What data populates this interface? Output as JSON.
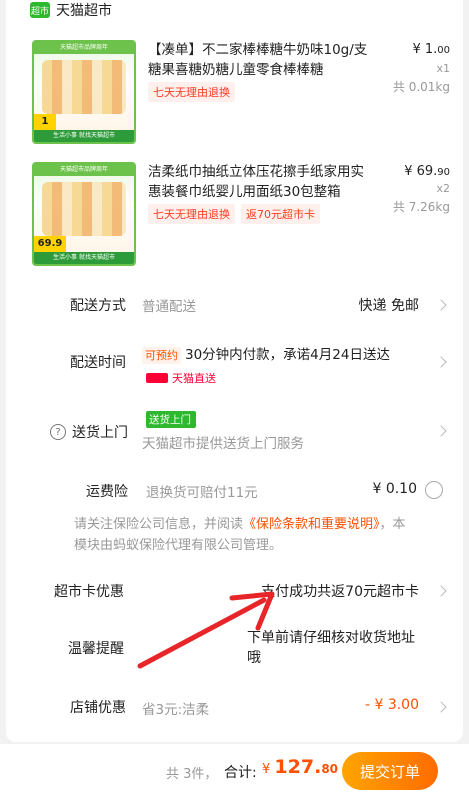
{
  "shop": {
    "logo_text": "超市",
    "name": "天猫超市"
  },
  "products": [
    {
      "thumb_banner": "天猫超市品牌周年",
      "thumb_footer": "生活小事 就找天猫超市",
      "thumb_price": "1",
      "title": "【凑单】不二家棒棒糖牛奶味10g/支糖果喜糖奶糖儿童零食棒棒糖",
      "tags": [
        "七天无理由退换"
      ],
      "price_main": "¥ 1.",
      "price_dec": "00",
      "qty": "x1",
      "weight": "共 0.01kg"
    },
    {
      "thumb_banner": "天猫超市品牌周年",
      "thumb_footer": "生活小事 就找天猫超市",
      "thumb_price": "69.9",
      "title": "洁柔纸巾抽纸立体压花擦手纸家用实惠装餐巾纸婴儿用面纸30包整箱",
      "tags": [
        "七天无理由退换",
        "返70元超市卡"
      ],
      "price_main": "¥ 69.",
      "price_dec": "90",
      "qty": "x2",
      "weight": "共 7.26kg"
    }
  ],
  "delivery_method": {
    "label": "配送方式",
    "value": "普通配送",
    "right": "快递 免邮"
  },
  "delivery_time": {
    "label": "配送时间",
    "badge": "可预约",
    "text": "30分钟内付款，承诺4月24日送达",
    "carrier": "天猫直送"
  },
  "door_delivery": {
    "label": "送货上门",
    "badge": "送货上门",
    "value": "天猫超市提供送货上门服务"
  },
  "shipping_insurance": {
    "label": "运费险",
    "value": "退换货可赔付11元",
    "right": "¥ 0.10"
  },
  "notice": {
    "prefix": "请关注保险公司信息，并阅读",
    "link": "《保险条款和重要说明》",
    "suffix": "，本模块由蚂蚁保险代理有限公司管理。"
  },
  "supermarket_card": {
    "label": "超市卡优惠",
    "right": "支付成功共返70元超市卡"
  },
  "reminder": {
    "label": "温馨提醒",
    "right": "下单前请仔细核对收货地址哦"
  },
  "shop_discount": {
    "label": "店铺优惠",
    "value": "省3元:洁柔",
    "right": "- ¥ 3.00"
  },
  "bottom": {
    "count": "共 3件，",
    "total_label": "合计:",
    "currency": "¥",
    "total_int": "127.",
    "total_dec": "80",
    "submit": "提交订单"
  },
  "colors": {
    "accent": "#ff5000",
    "tmall_green": "#2eb82e",
    "tmall_red": "#ff0036"
  }
}
